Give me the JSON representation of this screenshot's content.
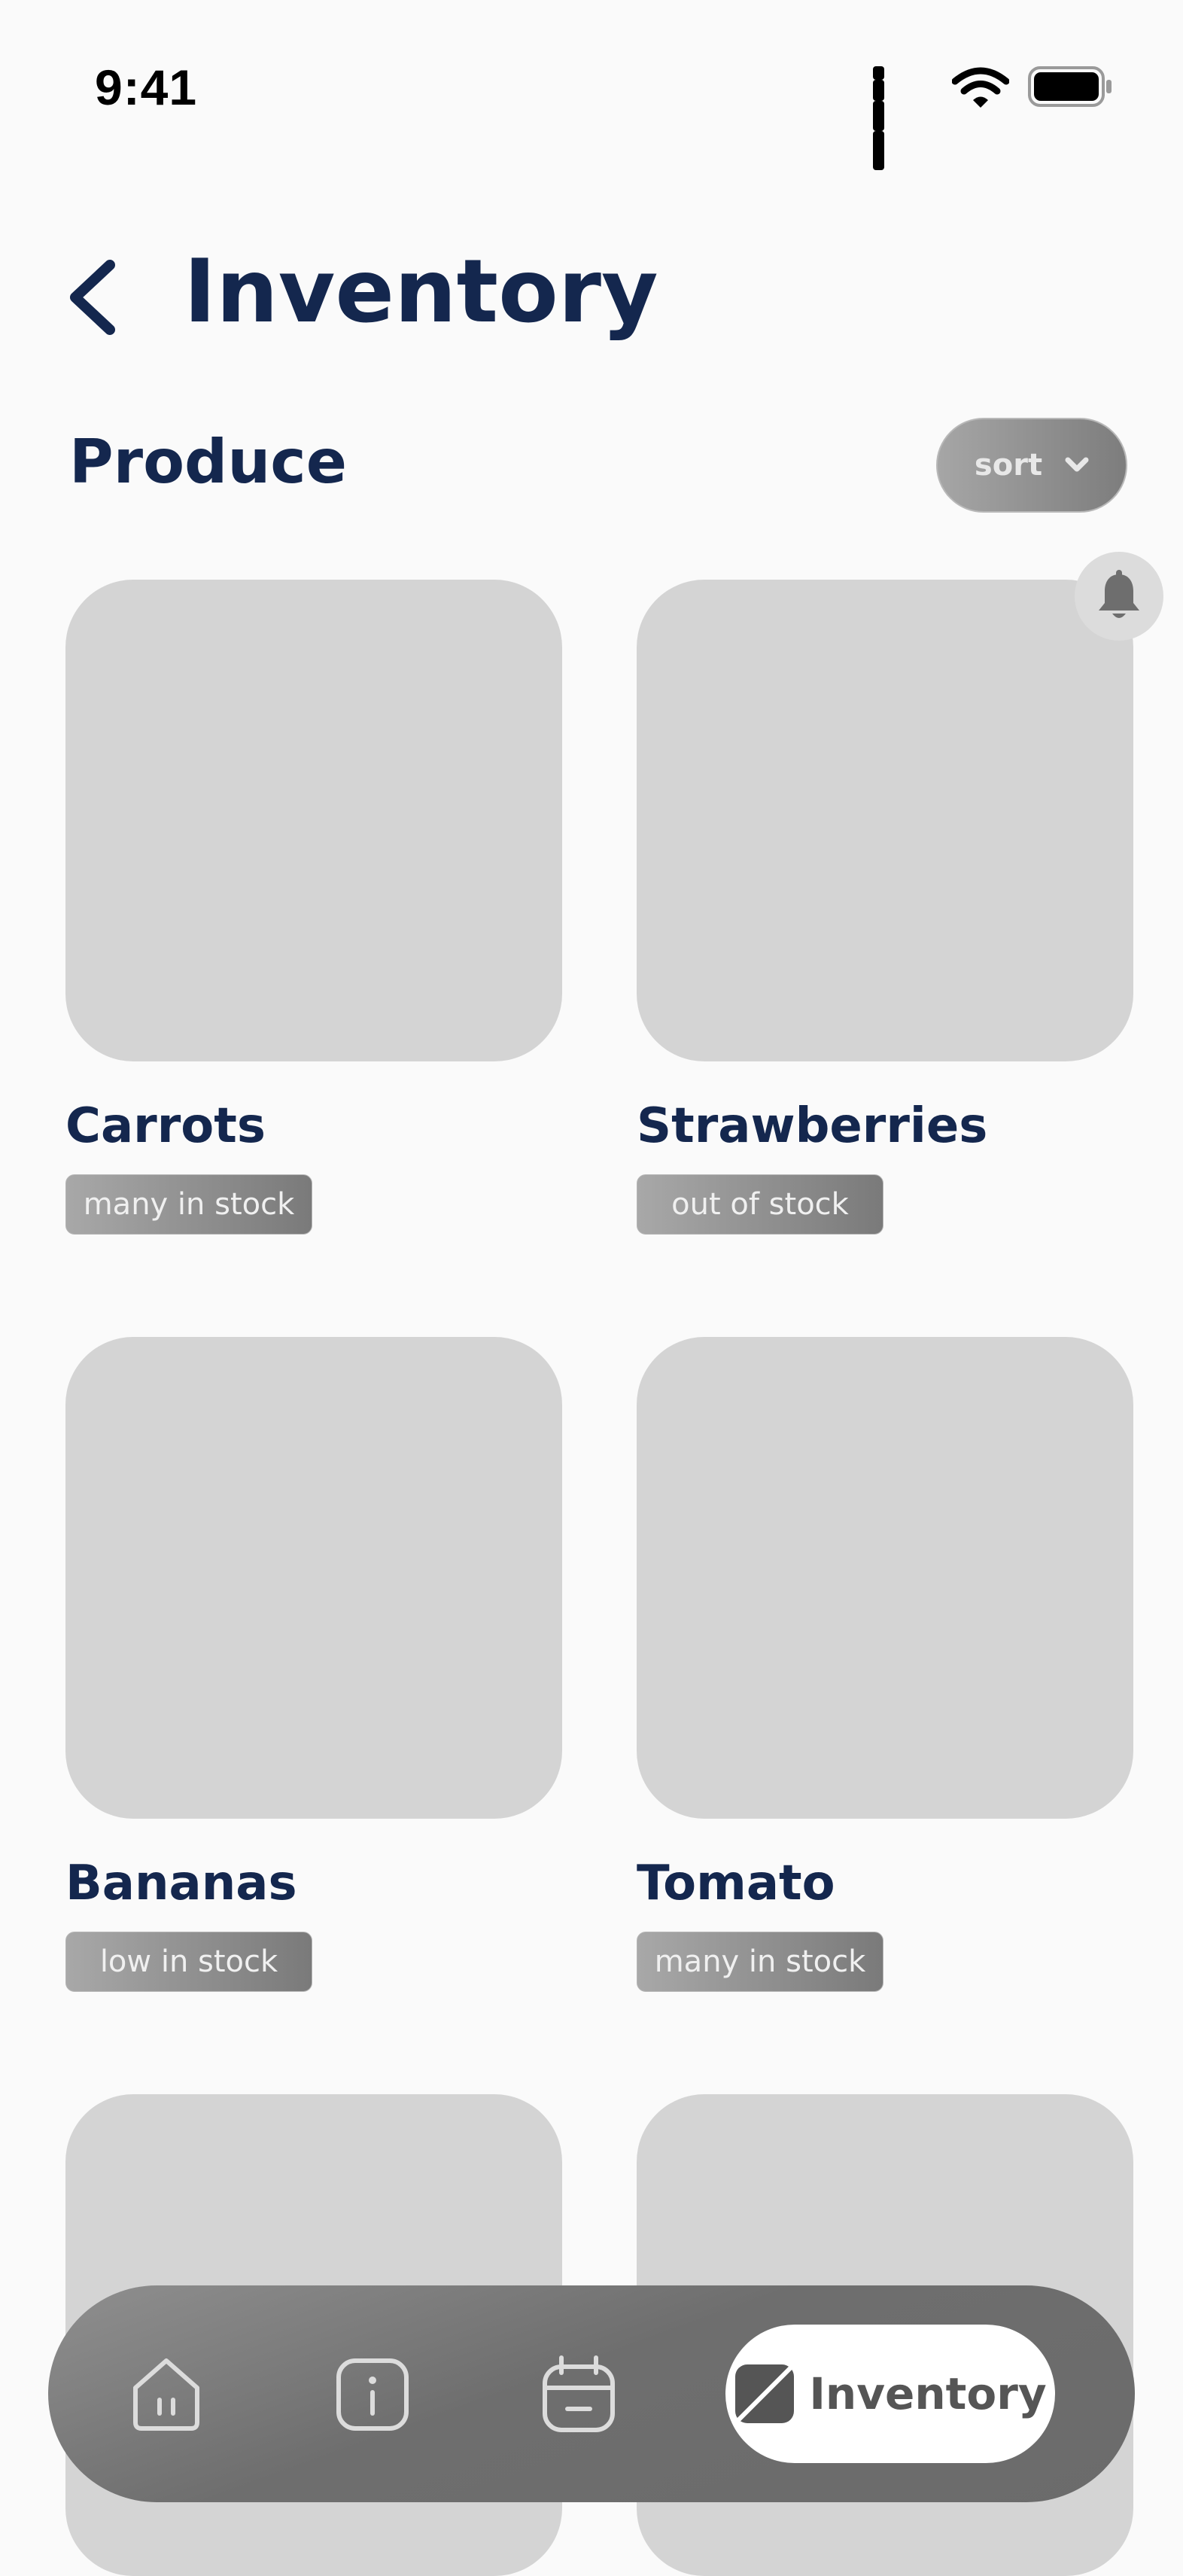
{
  "status_bar": {
    "time": "9:41"
  },
  "header": {
    "title": "Inventory",
    "back_icon": "chevron-left-icon"
  },
  "section": {
    "title": "Produce",
    "sort_label": "sort"
  },
  "products": [
    {
      "name": "Carrots",
      "stock": "many in stock"
    },
    {
      "name": "Strawberries",
      "stock": "out of stock",
      "has_alert": true
    },
    {
      "name": "Bananas",
      "stock": "low in stock"
    },
    {
      "name": "Tomato",
      "stock": "many in stock"
    }
  ],
  "bottom_nav": {
    "items": [
      {
        "icon": "home-icon"
      },
      {
        "icon": "info-icon"
      },
      {
        "icon": "calendar-icon"
      }
    ],
    "active_label": "Inventory",
    "active_icon": "inventory-icon"
  },
  "colors": {
    "title": "#14274e",
    "placeholder": "#d4d4d4",
    "nav_bg": "#707070"
  }
}
